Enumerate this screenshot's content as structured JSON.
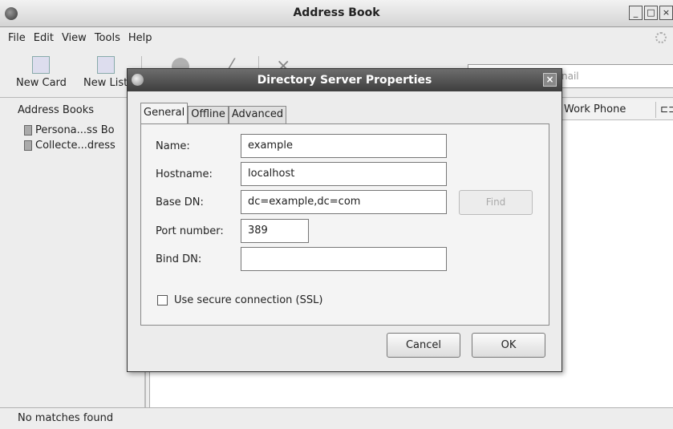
{
  "window": {
    "title": "Address Book",
    "min_glyph": "_",
    "max_glyph": "□",
    "close_glyph": "×"
  },
  "menu": {
    "items": [
      "File",
      "Edit",
      "View",
      "Tools",
      "Help"
    ]
  },
  "toolbar": {
    "new_card": "New Card",
    "new_list": "New List"
  },
  "search": {
    "placeholder_tail": "nail"
  },
  "address_books": {
    "header": "Address Books",
    "items": [
      "Persona...ss Bo",
      "Collecte...dress"
    ]
  },
  "results": {
    "columns": {
      "work_phone": "Work Phone",
      "picker_glyph": "⊏⊐"
    }
  },
  "status": {
    "text": "No matches found"
  },
  "dialog": {
    "title": "Directory Server Properties",
    "close_glyph": "×",
    "tabs": [
      "General",
      "Offline",
      "Advanced"
    ],
    "active_tab": "General",
    "fields": {
      "name_label": "Name:",
      "name_value": "example",
      "hostname_label": "Hostname:",
      "hostname_value": "localhost",
      "base_dn_label": "Base DN:",
      "base_dn_value": "dc=example,dc=com",
      "port_label": "Port number:",
      "port_value": "389",
      "bind_dn_label": "Bind DN:",
      "bind_dn_value": ""
    },
    "find_label": "Find",
    "ssl_label": "Use secure connection (SSL)",
    "ssl_checked": false,
    "cancel_label": "Cancel",
    "ok_label": "OK"
  }
}
